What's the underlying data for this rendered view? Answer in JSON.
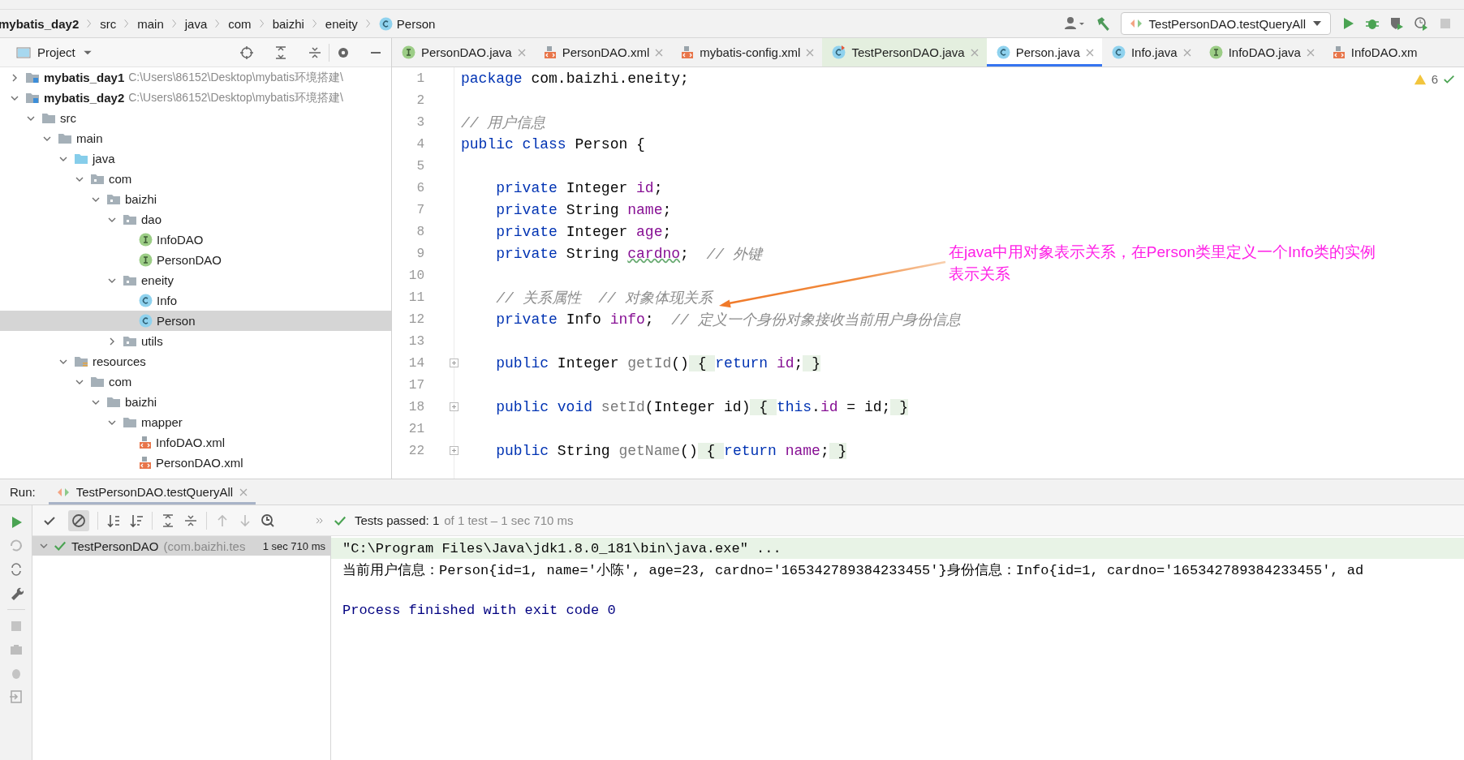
{
  "breadcrumbs": [
    {
      "label": "mybatis_day2",
      "kind": "module"
    },
    {
      "label": "src",
      "kind": "folder"
    },
    {
      "label": "main",
      "kind": "folder"
    },
    {
      "label": "java",
      "kind": "folder"
    },
    {
      "label": "com",
      "kind": "folder"
    },
    {
      "label": "baizhi",
      "kind": "folder"
    },
    {
      "label": "eneity",
      "kind": "folder"
    },
    {
      "label": "Person",
      "kind": "class"
    }
  ],
  "run_config": {
    "label": "TestPersonDAO.testQueryAll"
  },
  "project_panel": {
    "title": "Project",
    "tree": [
      {
        "label": "mybatis_day1",
        "kind": "module",
        "path": "C:\\Users\\86152\\Desktop\\mybatis环境搭建\\",
        "expanded": false,
        "selected": false
      },
      {
        "label": "mybatis_day2",
        "kind": "module",
        "path": "C:\\Users\\86152\\Desktop\\mybatis环境搭建\\",
        "expanded": true,
        "selected": false,
        "children": [
          {
            "label": "src",
            "kind": "folder",
            "expanded": true,
            "selected": false,
            "children": [
              {
                "label": "main",
                "kind": "folder",
                "expanded": true,
                "selected": false,
                "children": [
                  {
                    "label": "java",
                    "kind": "source",
                    "expanded": true,
                    "selected": false,
                    "children": [
                      {
                        "label": "com",
                        "kind": "package",
                        "expanded": true,
                        "selected": false,
                        "children": [
                          {
                            "label": "baizhi",
                            "kind": "package",
                            "expanded": true,
                            "selected": false,
                            "children": [
                              {
                                "label": "dao",
                                "kind": "package",
                                "expanded": true,
                                "selected": false,
                                "children": [
                                  {
                                    "label": "InfoDAO",
                                    "kind": "interface",
                                    "selected": false
                                  },
                                  {
                                    "label": "PersonDAO",
                                    "kind": "interface",
                                    "selected": false
                                  }
                                ]
                              },
                              {
                                "label": "eneity",
                                "kind": "package",
                                "expanded": true,
                                "selected": false,
                                "children": [
                                  {
                                    "label": "Info",
                                    "kind": "class",
                                    "selected": false
                                  },
                                  {
                                    "label": "Person",
                                    "kind": "class",
                                    "selected": true
                                  }
                                ]
                              },
                              {
                                "label": "utils",
                                "kind": "package",
                                "expanded": false,
                                "selected": false
                              }
                            ]
                          }
                        ]
                      }
                    ]
                  },
                  {
                    "label": "resources",
                    "kind": "resources",
                    "expanded": true,
                    "selected": false,
                    "children": [
                      {
                        "label": "com",
                        "kind": "folder",
                        "expanded": true,
                        "selected": false,
                        "children": [
                          {
                            "label": "baizhi",
                            "kind": "folder",
                            "expanded": true,
                            "selected": false,
                            "children": [
                              {
                                "label": "mapper",
                                "kind": "folder",
                                "expanded": true,
                                "selected": false,
                                "children": [
                                  {
                                    "label": "InfoDAO.xml",
                                    "kind": "xml",
                                    "selected": false
                                  },
                                  {
                                    "label": "PersonDAO.xml",
                                    "kind": "xml",
                                    "selected": false
                                  }
                                ]
                              }
                            ]
                          }
                        ]
                      }
                    ]
                  }
                ]
              }
            ]
          }
        ]
      }
    ]
  },
  "editor_tabs": [
    {
      "label": "PersonDAO.java",
      "kind": "interface",
      "selected": false
    },
    {
      "label": "PersonDAO.xml",
      "kind": "xml",
      "selected": false
    },
    {
      "label": "mybatis-config.xml",
      "kind": "xml",
      "selected": false
    },
    {
      "label": "TestPersonDAO.java",
      "kind": "test",
      "selected": false
    },
    {
      "label": "Person.java",
      "kind": "class",
      "selected": true
    },
    {
      "label": "Info.java",
      "kind": "class",
      "selected": false
    },
    {
      "label": "InfoDAO.java",
      "kind": "interface",
      "selected": false
    },
    {
      "label": "InfoDAO.xm",
      "kind": "xml",
      "selected": false
    }
  ],
  "warnings": {
    "count": "6"
  },
  "code_lines": [
    {
      "number": "1",
      "tokens": [
        {
          "kind": "kw",
          "text": "package"
        },
        {
          "kind": "plain",
          "text": " com.baizhi.eneity;"
        }
      ]
    },
    {
      "number": "2"
    },
    {
      "number": "3",
      "tokens": [
        {
          "kind": "comment",
          "text": "// 用户信息"
        }
      ]
    },
    {
      "number": "4",
      "tokens": [
        {
          "kind": "kw",
          "text": "public class"
        },
        {
          "kind": "plain",
          "text": " Person {"
        }
      ]
    },
    {
      "number": "5"
    },
    {
      "number": "6",
      "tokens": [
        {
          "kind": "kw",
          "text": "    private"
        },
        {
          "kind": "plain",
          "text": " Integer "
        },
        {
          "kind": "field",
          "text": "id"
        },
        {
          "kind": "plain",
          "text": ";"
        }
      ]
    },
    {
      "number": "7",
      "tokens": [
        {
          "kind": "kw",
          "text": "    private"
        },
        {
          "kind": "plain",
          "text": " String "
        },
        {
          "kind": "field",
          "text": "name"
        },
        {
          "kind": "plain",
          "text": ";"
        }
      ]
    },
    {
      "number": "8",
      "tokens": [
        {
          "kind": "kw",
          "text": "    private"
        },
        {
          "kind": "plain",
          "text": " Integer "
        },
        {
          "kind": "field",
          "text": "age"
        },
        {
          "kind": "plain",
          "text": ";"
        }
      ]
    },
    {
      "number": "9",
      "tokens": [
        {
          "kind": "kw",
          "text": "    private"
        },
        {
          "kind": "plain",
          "text": " String "
        },
        {
          "kind": "typo",
          "text": "cardno"
        },
        {
          "kind": "plain",
          "text": ";  "
        },
        {
          "kind": "comment",
          "text": "// 外键"
        }
      ]
    },
    {
      "number": "10"
    },
    {
      "number": "11",
      "tokens": [
        {
          "kind": "comment",
          "text": "    // 关系属性  // 对象体现关系"
        }
      ]
    },
    {
      "number": "12",
      "tokens": [
        {
          "kind": "kw",
          "text": "    private"
        },
        {
          "kind": "plain",
          "text": " Info "
        },
        {
          "kind": "field",
          "text": "info"
        },
        {
          "kind": "plain",
          "text": ";  "
        },
        {
          "kind": "comment",
          "text": "// 定义一个身份对象接收当前用户身份信息"
        }
      ]
    },
    {
      "number": "13"
    },
    {
      "number": "14",
      "fold": true,
      "tokens": [
        {
          "kind": "kw",
          "text": "    public"
        },
        {
          "kind": "plain",
          "text": " Integer "
        },
        {
          "kind": "dim",
          "text": "getId"
        },
        {
          "kind": "plain",
          "text": "()"
        },
        {
          "kind": "folded",
          "text": " { "
        },
        {
          "kind": "kw",
          "text": "return "
        },
        {
          "kind": "field",
          "text": "id"
        },
        {
          "kind": "plain",
          "text": ";"
        },
        {
          "kind": "folded",
          "text": " }"
        }
      ]
    },
    {
      "number": "17"
    },
    {
      "number": "18",
      "fold": true,
      "tokens": [
        {
          "kind": "kw",
          "text": "    public void"
        },
        {
          "kind": "dim",
          "text": " setId"
        },
        {
          "kind": "plain",
          "text": "(Integer id)"
        },
        {
          "kind": "folded",
          "text": " { "
        },
        {
          "kind": "kw",
          "text": "this"
        },
        {
          "kind": "plain",
          "text": "."
        },
        {
          "kind": "field",
          "text": "id"
        },
        {
          "kind": "plain",
          "text": " = id;"
        },
        {
          "kind": "folded",
          "text": " }"
        }
      ]
    },
    {
      "number": "21"
    },
    {
      "number": "22",
      "fold": true,
      "tokens": [
        {
          "kind": "kw",
          "text": "    public"
        },
        {
          "kind": "plain",
          "text": " String "
        },
        {
          "kind": "dim",
          "text": "getName"
        },
        {
          "kind": "plain",
          "text": "()"
        },
        {
          "kind": "folded",
          "text": " { "
        },
        {
          "kind": "kw",
          "text": "return "
        },
        {
          "kind": "field",
          "text": "name"
        },
        {
          "kind": "plain",
          "text": ";"
        },
        {
          "kind": "folded",
          "text": " }"
        }
      ]
    }
  ],
  "annotation": {
    "lines": [
      "在java中用对象表示关系，在Person类里定义一个Info类的实例",
      "表示关系"
    ]
  },
  "run_panel": {
    "label": "Run:",
    "tab": "TestPersonDAO.testQueryAll",
    "status": "Tests passed: 1",
    "status_detail": "of 1 test – 1 sec 710 ms",
    "test": {
      "name": "TestPersonDAO",
      "package": "(com.baizhi.tes",
      "time": "1 sec 710 ms",
      "expanded": true
    },
    "console": [
      {
        "kind": "command",
        "text": "\"C:\\Program Files\\Java\\jdk1.8.0_181\\bin\\java.exe\" ..."
      },
      {
        "kind": "output",
        "text": "当前用户信息：Person{id=1, name='小陈', age=23, cardno='165342789384233455'}身份信息：Info{id=1, cardno='165342789384233455', ad"
      },
      {
        "kind": "exit",
        "text": "Process finished with exit code 0"
      }
    ]
  }
}
